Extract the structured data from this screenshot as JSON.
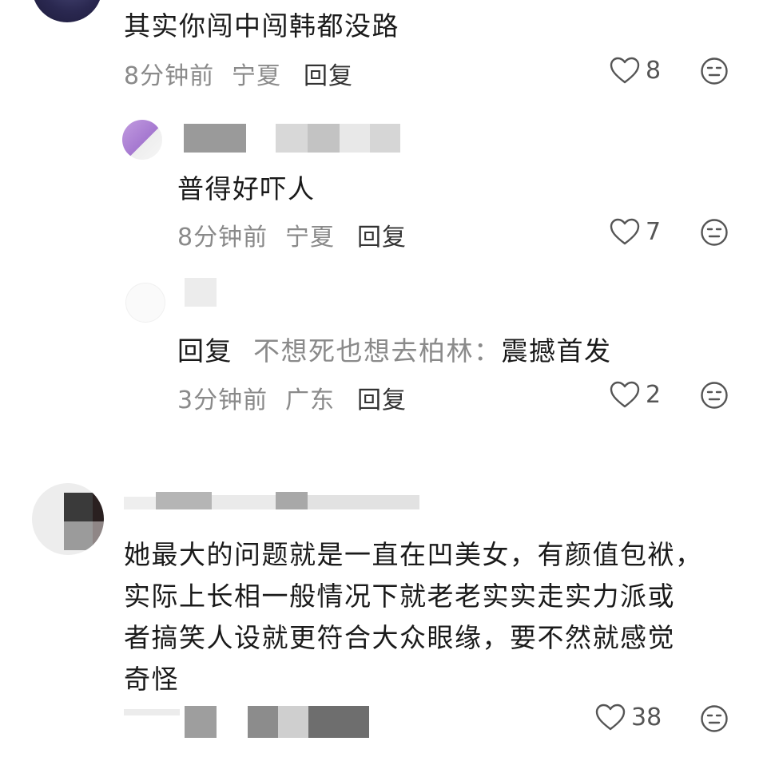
{
  "comments": [
    {
      "text": "其实你闯中闯韩都没路",
      "time": "8分钟前",
      "location": "宁夏",
      "reply_label": "回复",
      "likes": "8"
    },
    {
      "text": "普得好吓人",
      "time": "8分钟前",
      "location": "宁夏",
      "reply_label": "回复",
      "likes": "7"
    },
    {
      "reply_prefix": "回复",
      "reply_to": "不想死也想去柏林：",
      "text": "震撼首发",
      "time": "3分钟前",
      "location": "广东",
      "reply_label": "回复",
      "likes": "2"
    },
    {
      "lines": [
        "她最大的问题就是一直在凹美女，有颜值包袱，",
        "实际上长相一般情况下就老老实实走实力派或",
        "者搞笑人设就更符合大众眼缘，要不然就感觉",
        "奇怪"
      ],
      "likes": "38"
    }
  ],
  "icons": {
    "like": "heart-outline-icon",
    "dislike": "neutral-face-icon"
  },
  "colors": {
    "text": "#1a1a1a",
    "meta": "#8a8a8a",
    "icon": "#555555"
  }
}
